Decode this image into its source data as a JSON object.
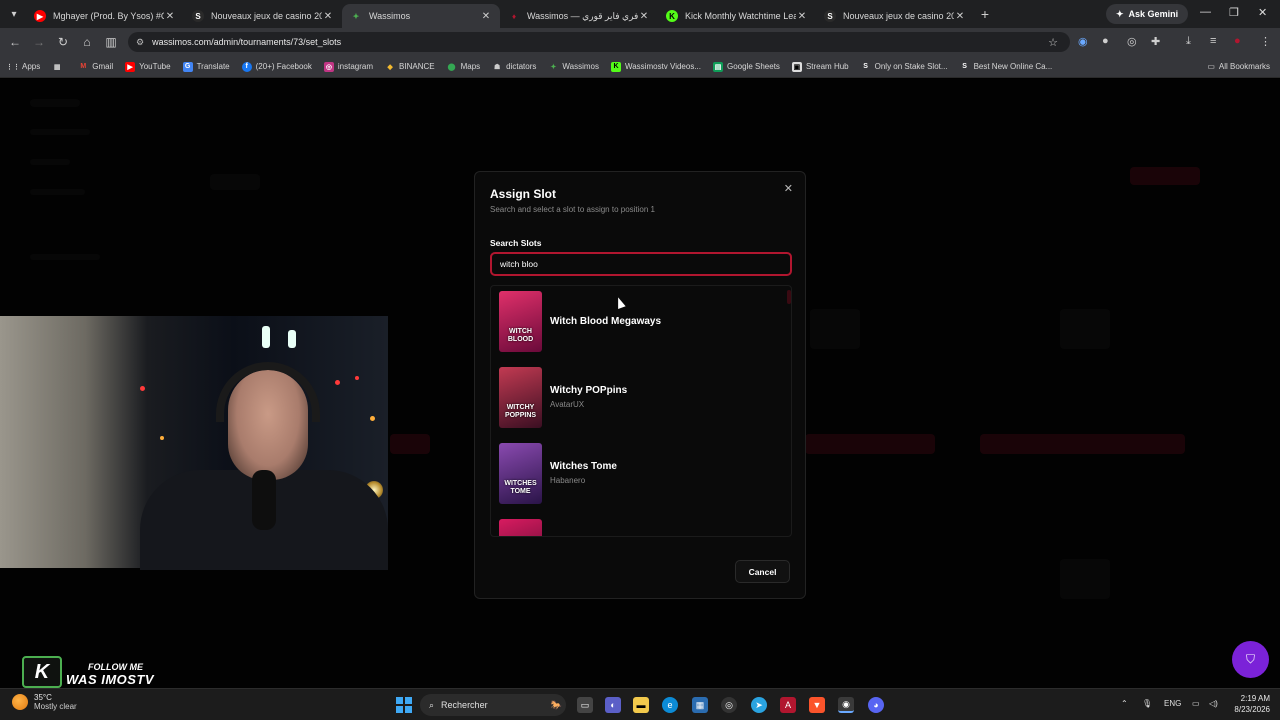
{
  "browser": {
    "tabs": [
      {
        "title": "Mghayer (Prod. By Ysos) #CAM",
        "favicon": "youtube-icon",
        "color": "#ff0000"
      },
      {
        "title": "Nouveaux jeux de casino 2026",
        "favicon": "stake-icon",
        "color": "#2a2a2a"
      },
      {
        "title": "Wassimos",
        "favicon": "wassimos-icon",
        "color": "#4caf50"
      },
      {
        "title": "Wassimos — واهر فري فاير قوري",
        "favicon": "wassimos-icon",
        "color": "#b1162f"
      },
      {
        "title": "Kick Monthly Watchtime Leade",
        "favicon": "kick-icon",
        "color": "#53fc18"
      },
      {
        "title": "Nouveaux jeux de casino 2026",
        "favicon": "stake-icon",
        "color": "#2a2a2a"
      }
    ],
    "active_tab": 2,
    "ask_gemini": "Ask Gemini",
    "url": "wassimos.com/admin/tournaments/73/set_slots",
    "bookmarks": [
      {
        "label": "Apps"
      },
      {
        "label": "Gmail"
      },
      {
        "label": "YouTube"
      },
      {
        "label": "Translate"
      },
      {
        "label": "(20+) Facebook"
      },
      {
        "label": "instagram"
      },
      {
        "label": "BINANCE"
      },
      {
        "label": "Maps"
      },
      {
        "label": "dictators"
      },
      {
        "label": "Wassimos"
      },
      {
        "label": "Wassimostv Videos..."
      },
      {
        "label": "Google Sheets"
      },
      {
        "label": "Stream Hub"
      },
      {
        "label": "Only on Stake Slot..."
      },
      {
        "label": "Best New Online Ca..."
      }
    ],
    "all_bookmarks": "All Bookmarks"
  },
  "modal": {
    "title": "Assign Slot",
    "subtitle": "Search and select a slot to assign to position 1",
    "search_label": "Search Slots",
    "search_value": "witch bloo",
    "results": [
      {
        "name": "Witch Blood Megaways",
        "provider": "",
        "thumb_text": "WITCH BLOOD",
        "thumb_color": "#a8124a"
      },
      {
        "name": "Witchy POPpins",
        "provider": "AvatarUX",
        "thumb_text": "WITCHY POPPINS",
        "thumb_color": "#8a1f3a"
      },
      {
        "name": "Witches Tome",
        "provider": "Habanero",
        "thumb_text": "WITCHES TOME",
        "thumb_color": "#5a2a7a"
      }
    ],
    "cancel_label": "Cancel"
  },
  "overlay_text": {
    "follow_top": "FOLLOW ME",
    "follow_name": "WAS IMOSTV"
  },
  "taskbar": {
    "weather_temp": "35°C",
    "weather_desc": "Mostly clear",
    "search_placeholder": "Rechercher",
    "lang": "ENG",
    "time": "2:19 AM",
    "date": "8/23/2026"
  },
  "colors": {
    "accent": "#b1162f",
    "fab": "#7b22d8"
  }
}
